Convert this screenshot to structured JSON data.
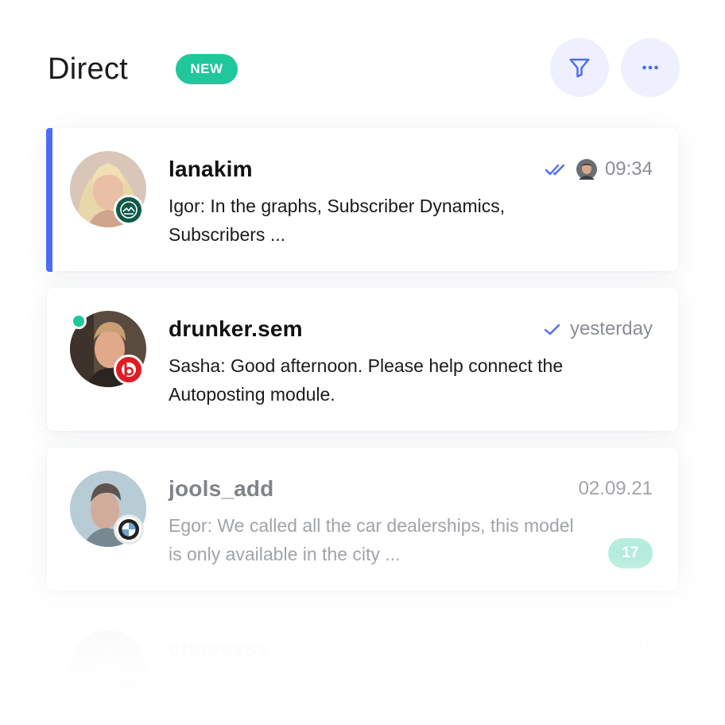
{
  "header": {
    "title": "Direct",
    "badge": "NEW"
  },
  "colors": {
    "accent": "#4d6cf6",
    "badge": "#1fc79a",
    "button_bg": "#eef1fd"
  },
  "icons": {
    "filter": "filter-icon",
    "more": "more-dots-icon",
    "read": "double-check-icon",
    "sent": "single-check-icon"
  },
  "conversations": [
    {
      "username": "lanakim",
      "message": "Igor: In the graphs, Subscriber Dynamics, Subscribers ...",
      "time": "09:34",
      "status": "read",
      "brand": "green-seal-logo",
      "online": false,
      "unread": null
    },
    {
      "username": "drunker.sem",
      "message": "Sasha: Good afternoon. Please help connect the Autoposting module.",
      "time": "yesterday",
      "status": "sent",
      "brand": "beats-logo",
      "online": true,
      "unread": null
    },
    {
      "username": "jools_add",
      "message": "Egor: We called all the car dealerships, this model is only available in the city ...",
      "time": "02.09.21",
      "status": null,
      "brand": "bmw-logo",
      "online": false,
      "unread": "17"
    },
    {
      "username": "chavesss",
      "message": "Jose: On Thursday we have a corporate",
      "time": "31.08.21",
      "status": null,
      "brand": "brand-logo",
      "online": false,
      "unread": null
    }
  ]
}
